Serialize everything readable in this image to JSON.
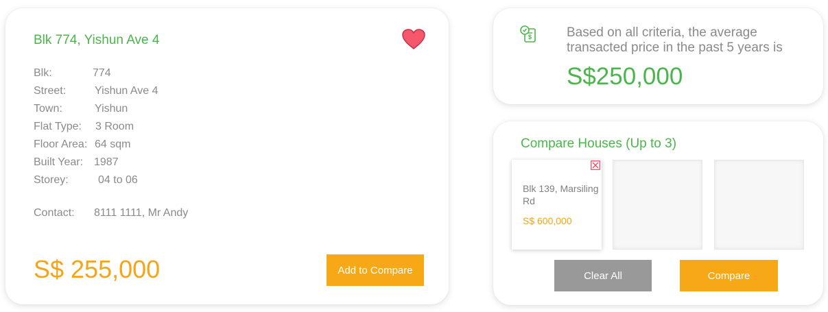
{
  "listing": {
    "title": "Blk 774, Yishun Ave 4",
    "favorite": true,
    "details": [
      {
        "label": "Blk:",
        "value": "774"
      },
      {
        "label": "Street:",
        "value": "Yishun Ave 4"
      },
      {
        "label": "Town:",
        "value": "Yishun"
      },
      {
        "label": "Flat Type:",
        "value": "3 Room"
      },
      {
        "label": "Floor Area:",
        "value": "64 sqm"
      },
      {
        "label": "Built Year:",
        "value": "1987"
      },
      {
        "label": "Storey:",
        "value": "04 to 06"
      }
    ],
    "contact_label": "Contact:",
    "contact_value": "8111 1111, Mr Andy",
    "price": "S$ 255,000",
    "add_button": "Add to Compare"
  },
  "estimate": {
    "icon": "price-tag-document-icon",
    "note": "Based on all criteria, the average transacted price in the past 5 years is",
    "average_price": "S$250,000"
  },
  "compare": {
    "title": "Compare Houses (Up to 3)",
    "slots": [
      {
        "address": "Blk 139, Marsiling Rd",
        "price": "S$ 600,000"
      },
      {
        "address": "",
        "price": ""
      },
      {
        "address": "",
        "price": ""
      }
    ],
    "clear_button": "Clear All",
    "compare_button": "Compare"
  },
  "colors": {
    "accent_green": "#4ab54a",
    "accent_orange": "#f7a816",
    "heart_red": "#f0405a",
    "button_grey": "#999999",
    "text_grey": "#8a8a8a"
  }
}
